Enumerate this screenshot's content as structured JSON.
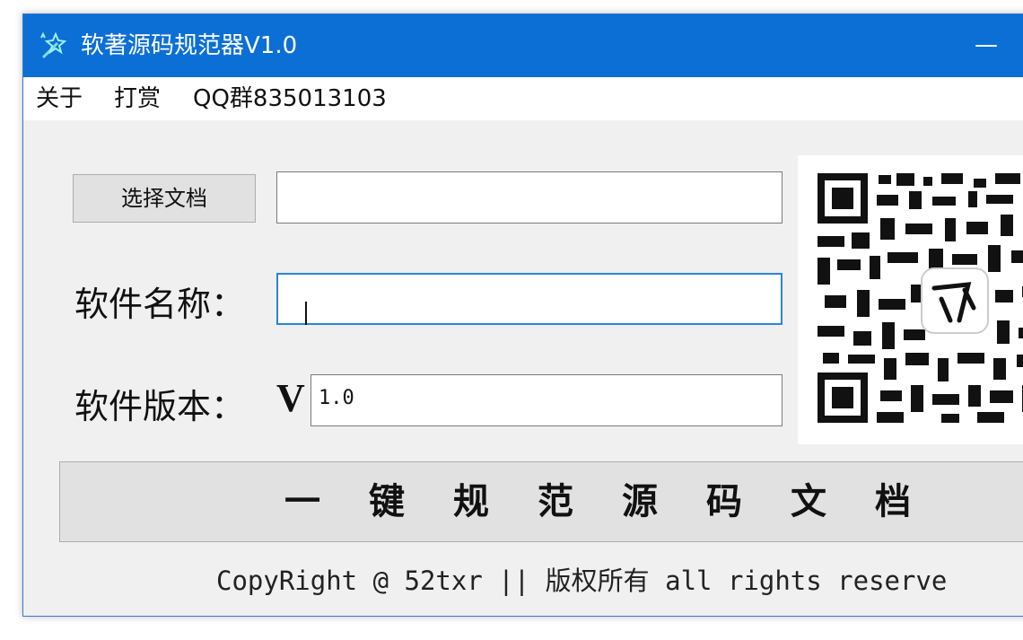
{
  "window": {
    "title": "软著源码规范器V1.0",
    "minimize_glyph": "—"
  },
  "menu": {
    "items": [
      "关于",
      "打赏",
      "QQ群835013103"
    ]
  },
  "form": {
    "choose_button": "选择文档",
    "document_path": "",
    "software_name_label": "软件名称：",
    "software_name_value": "",
    "software_version_label": "软件版本：",
    "version_prefix": "V",
    "software_version_value": "1.0"
  },
  "action": {
    "format_button": "一键规范源码文档"
  },
  "footer": {
    "copyright": "CopyRight @ 52txr || 版权所有 all rights reserve"
  },
  "colors": {
    "titlebar": "#0b6fd6",
    "window_bg": "#f0f0f0",
    "focus_border": "#2a86d8"
  },
  "icons": {
    "app_icon": "sparkle-wand-icon",
    "qr": "qr-code-image"
  }
}
